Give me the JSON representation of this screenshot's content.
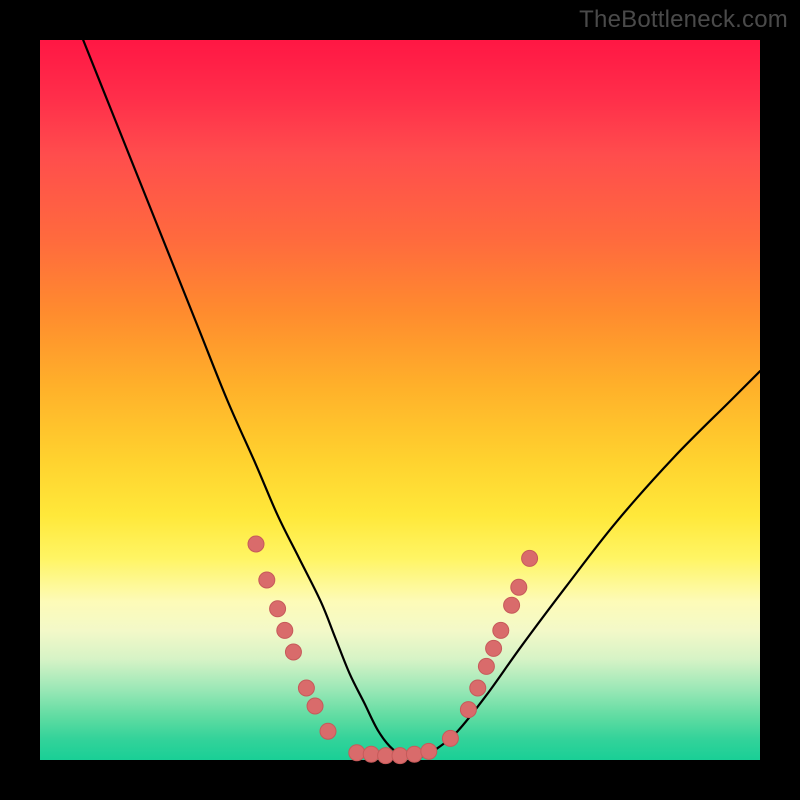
{
  "watermark": "TheBottleneck.com",
  "chart_data": {
    "type": "line",
    "title": "",
    "xlabel": "",
    "ylabel": "",
    "xlim": [
      0,
      100
    ],
    "ylim": [
      0,
      100
    ],
    "grid": false,
    "legend": false,
    "background_gradient_stops": [
      {
        "pos": 0,
        "color": "#ff1744"
      },
      {
        "pos": 50,
        "color": "#ffd12e"
      },
      {
        "pos": 80,
        "color": "#fdfbb8"
      },
      {
        "pos": 100,
        "color": "#19cf96"
      }
    ],
    "series": [
      {
        "name": "bottleneck-curve",
        "color": "#000000",
        "x": [
          6,
          10,
          14,
          18,
          22,
          26,
          30,
          33,
          36,
          39,
          41,
          43,
          45,
          47,
          49,
          51,
          53,
          55,
          58,
          62,
          67,
          73,
          80,
          88,
          96,
          100
        ],
        "y": [
          100,
          90,
          80,
          70,
          60,
          50,
          41,
          34,
          28,
          22,
          17,
          12,
          8,
          4,
          1.5,
          0.5,
          0.5,
          1.5,
          4,
          9,
          16,
          24,
          33,
          42,
          50,
          54
        ]
      }
    ],
    "scatter": [
      {
        "name": "marker-dots",
        "color": "#d96b6b",
        "points": [
          {
            "x": 30.0,
            "y": 30.0
          },
          {
            "x": 31.5,
            "y": 25.0
          },
          {
            "x": 33.0,
            "y": 21.0
          },
          {
            "x": 34.0,
            "y": 18.0
          },
          {
            "x": 35.2,
            "y": 15.0
          },
          {
            "x": 37.0,
            "y": 10.0
          },
          {
            "x": 38.2,
            "y": 7.5
          },
          {
            "x": 40.0,
            "y": 4.0
          },
          {
            "x": 44.0,
            "y": 1.0
          },
          {
            "x": 46.0,
            "y": 0.8
          },
          {
            "x": 48.0,
            "y": 0.6
          },
          {
            "x": 50.0,
            "y": 0.6
          },
          {
            "x": 52.0,
            "y": 0.8
          },
          {
            "x": 54.0,
            "y": 1.2
          },
          {
            "x": 57.0,
            "y": 3.0
          },
          {
            "x": 59.5,
            "y": 7.0
          },
          {
            "x": 60.8,
            "y": 10.0
          },
          {
            "x": 62.0,
            "y": 13.0
          },
          {
            "x": 63.0,
            "y": 15.5
          },
          {
            "x": 64.0,
            "y": 18.0
          },
          {
            "x": 65.5,
            "y": 21.5
          },
          {
            "x": 66.5,
            "y": 24.0
          },
          {
            "x": 68.0,
            "y": 28.0
          }
        ]
      }
    ]
  }
}
